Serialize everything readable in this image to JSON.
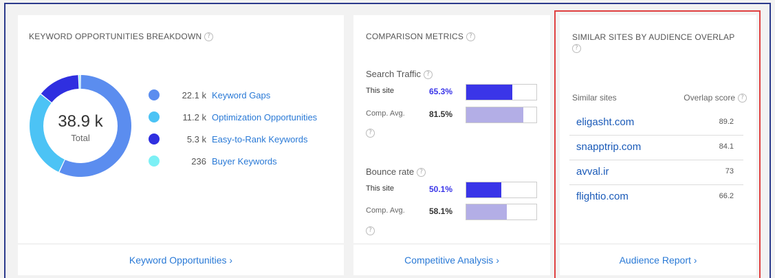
{
  "colors": {
    "link": "#2979d6",
    "keyword_gaps": "#5b8def",
    "optimization": "#4cc3f5",
    "easy_to_rank": "#2f2fe0",
    "buyer": "#7cf0f5",
    "site_bar": "#3a35e8",
    "comp_bar": "#b3aee6",
    "highlight_border": "#e04040"
  },
  "keyword_card": {
    "title": "Keyword Opportunities Breakdown",
    "help": "?",
    "total_value": "38.9 k",
    "total_label": "Total",
    "legend": [
      {
        "value": "22.1 k",
        "label": "Keyword Gaps",
        "share": 0.568,
        "color": "#5b8def"
      },
      {
        "value": "11.2 k",
        "label": "Optimization Opportunities",
        "share": 0.288,
        "color": "#4cc3f5"
      },
      {
        "value": "5.3 k",
        "label": "Easy-to-Rank Keywords",
        "share": 0.136,
        "color": "#2f2fe0"
      },
      {
        "value": "236",
        "label": "Buyer Keywords",
        "share": 0.006,
        "color": "#7cf0f5"
      }
    ],
    "footer": "Keyword Opportunities ›"
  },
  "comparison_card": {
    "title": "Comparison Metrics",
    "help": "?",
    "search_traffic": {
      "title": "Search Traffic",
      "site_label": "This site",
      "site_pct": "65.3%",
      "site_fraction": 0.653,
      "comp_label": "Comp. Avg.",
      "comp_pct": "81.5%",
      "comp_fraction": 0.815
    },
    "bounce_rate": {
      "title": "Bounce rate",
      "site_label": "This site",
      "site_pct": "50.1%",
      "site_fraction": 0.501,
      "comp_label": "Comp. Avg.",
      "comp_pct": "58.1%",
      "comp_fraction": 0.581
    },
    "footer": "Competitive Analysis ›"
  },
  "similar_card": {
    "title_line1": "Similar Sites by Audience Overlap",
    "help": "?",
    "col_site": "Similar sites",
    "col_score": "Overlap score",
    "sites": [
      {
        "name": "eligasht.com",
        "score": "89.2"
      },
      {
        "name": "snapptrip.com",
        "score": "84.1"
      },
      {
        "name": "avval.ir",
        "score": "73"
      },
      {
        "name": "flightio.com",
        "score": "66.2"
      }
    ],
    "footer": "Audience Report ›"
  }
}
